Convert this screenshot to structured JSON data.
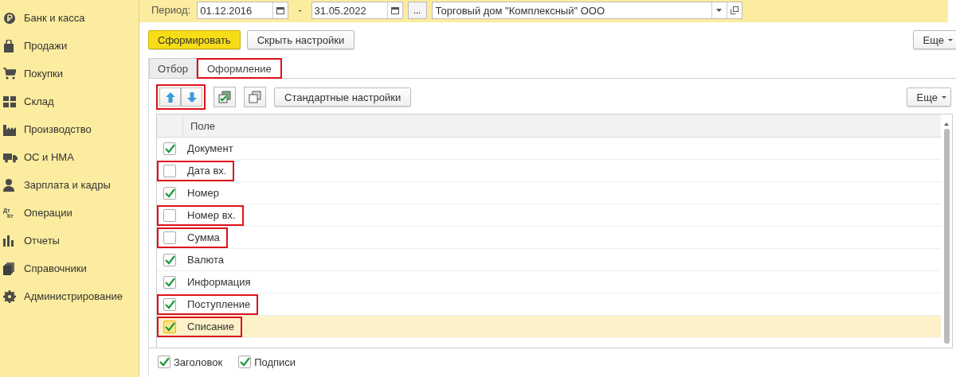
{
  "sidebar": {
    "items": [
      {
        "label": "Банк и касса"
      },
      {
        "label": "Продажи"
      },
      {
        "label": "Покупки"
      },
      {
        "label": "Склад"
      },
      {
        "label": "Производство"
      },
      {
        "label": "ОС и НМА"
      },
      {
        "label": "Зарплата и кадры"
      },
      {
        "label": "Операции",
        "icon_text": [
          "Дт",
          "Кт"
        ]
      },
      {
        "label": "Отчеты"
      },
      {
        "label": "Справочники"
      },
      {
        "label": "Администрирование"
      }
    ]
  },
  "period": {
    "label": "Период:",
    "from": "01.12.2016",
    "separator": "-",
    "to": "31.05.2022",
    "more_button": "...",
    "organization": "Торговый дом \"Комплексный\" ООО"
  },
  "actions": {
    "primary": "Сформировать",
    "secondary": "Скрыть настройки",
    "more": "Еще"
  },
  "tabs": [
    {
      "label": "Отбор",
      "selected": false,
      "highlighted": false
    },
    {
      "label": "Оформление",
      "selected": true,
      "highlighted": true
    }
  ],
  "toolbar": {
    "move_highlighted": true,
    "standard": "Стандартные настройки",
    "more": "Еще"
  },
  "table": {
    "column": "Поле",
    "rows": [
      {
        "label": "Документ",
        "checked": true,
        "selected": false,
        "highlighted": false
      },
      {
        "label": "Дата вх.",
        "checked": false,
        "selected": false,
        "highlighted": true
      },
      {
        "label": "Номер",
        "checked": true,
        "selected": false,
        "highlighted": false
      },
      {
        "label": "Номер вх.",
        "checked": false,
        "selected": false,
        "highlighted": true
      },
      {
        "label": "Сумма",
        "checked": false,
        "selected": false,
        "highlighted": true
      },
      {
        "label": "Валюта",
        "checked": true,
        "selected": false,
        "highlighted": false
      },
      {
        "label": "Информация",
        "checked": true,
        "selected": false,
        "highlighted": false
      },
      {
        "label": "Поступление",
        "checked": true,
        "selected": false,
        "highlighted": true
      },
      {
        "label": "Списание",
        "checked": true,
        "selected": true,
        "highlighted": true
      }
    ]
  },
  "footer": [
    {
      "label": "Заголовок",
      "checked": true
    },
    {
      "label": "Подписи",
      "checked": true
    }
  ]
}
